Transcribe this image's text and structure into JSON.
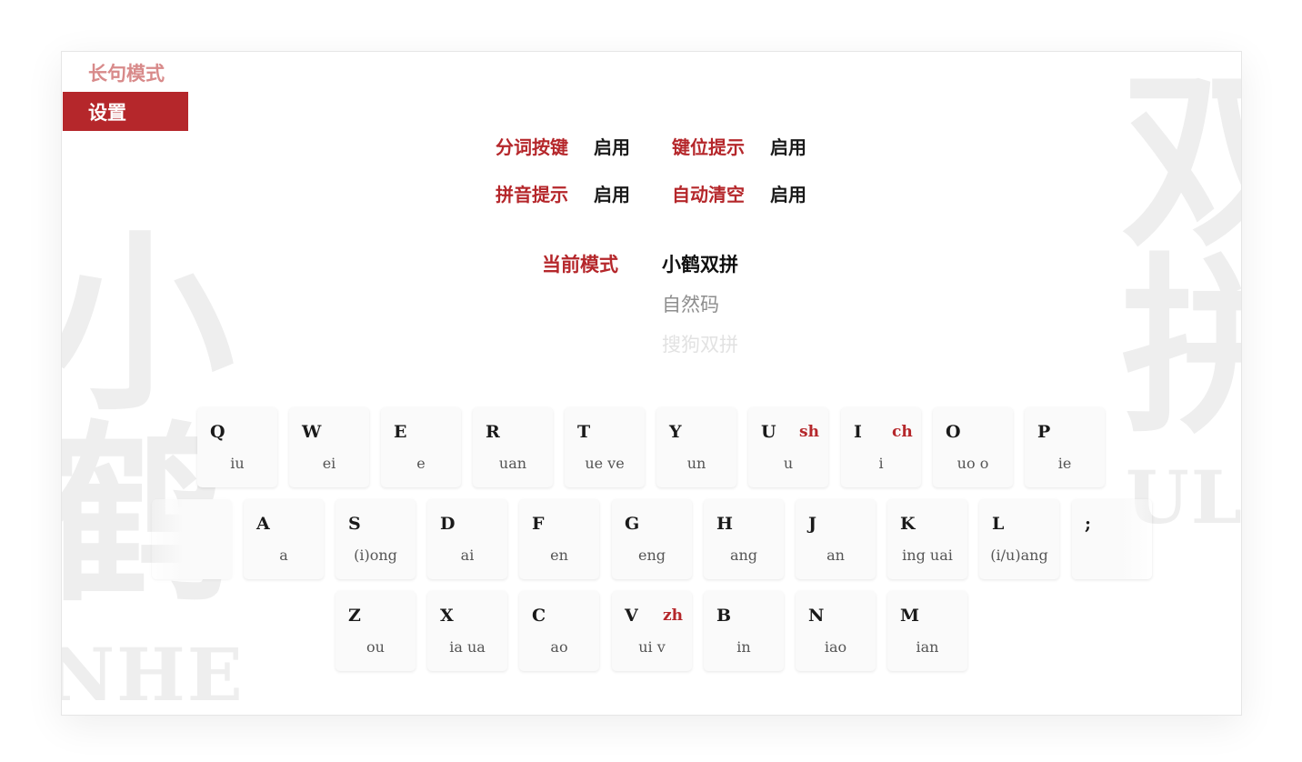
{
  "watermark": {
    "left_chars": [
      "小",
      "鹤"
    ],
    "left_text": "NHE",
    "right_chars": [
      "双",
      "拼"
    ],
    "right_text": "ULI"
  },
  "sidebar": {
    "items": [
      {
        "label": "长句模式",
        "active": false
      },
      {
        "label": "设置",
        "active": true
      }
    ]
  },
  "settings": {
    "options": [
      {
        "label": "分词按键",
        "value": "启用"
      },
      {
        "label": "键位提示",
        "value": "启用"
      },
      {
        "label": "拼音提示",
        "value": "启用"
      },
      {
        "label": "自动清空",
        "value": "启用"
      }
    ],
    "mode_label": "当前模式",
    "modes": [
      {
        "label": "小鹤双拼",
        "state": "selected"
      },
      {
        "label": "自然码",
        "state": "secondary"
      },
      {
        "label": "搜狗双拼",
        "state": "faded"
      }
    ]
  },
  "keyboard": {
    "rows": [
      [
        {
          "letter": "Q",
          "initial": "",
          "final": "iu"
        },
        {
          "letter": "W",
          "initial": "",
          "final": "ei"
        },
        {
          "letter": "E",
          "initial": "",
          "final": "e"
        },
        {
          "letter": "R",
          "initial": "",
          "final": "uan"
        },
        {
          "letter": "T",
          "initial": "",
          "final": "ue ve"
        },
        {
          "letter": "Y",
          "initial": "",
          "final": "un"
        },
        {
          "letter": "U",
          "initial": "sh",
          "final": "u"
        },
        {
          "letter": "I",
          "initial": "ch",
          "final": "i"
        },
        {
          "letter": "O",
          "initial": "",
          "final": "uo o"
        },
        {
          "letter": "P",
          "initial": "",
          "final": "ie"
        }
      ],
      [
        {
          "letter": "",
          "initial": "",
          "final": ""
        },
        {
          "letter": "A",
          "initial": "",
          "final": "a"
        },
        {
          "letter": "S",
          "initial": "",
          "final": "(i)ong"
        },
        {
          "letter": "D",
          "initial": "",
          "final": "ai"
        },
        {
          "letter": "F",
          "initial": "",
          "final": "en"
        },
        {
          "letter": "G",
          "initial": "",
          "final": "eng"
        },
        {
          "letter": "H",
          "initial": "",
          "final": "ang"
        },
        {
          "letter": "J",
          "initial": "",
          "final": "an"
        },
        {
          "letter": "K",
          "initial": "",
          "final": "ing uai"
        },
        {
          "letter": "L",
          "initial": "",
          "final": "(i/u)ang"
        },
        {
          "letter": ";",
          "initial": "",
          "final": ""
        }
      ],
      [
        {
          "letter": "Z",
          "initial": "",
          "final": "ou"
        },
        {
          "letter": "X",
          "initial": "",
          "final": "ia ua"
        },
        {
          "letter": "C",
          "initial": "",
          "final": "ao"
        },
        {
          "letter": "V",
          "initial": "zh",
          "final": "ui v"
        },
        {
          "letter": "B",
          "initial": "",
          "final": "in"
        },
        {
          "letter": "N",
          "initial": "",
          "final": "iao"
        },
        {
          "letter": "M",
          "initial": "",
          "final": "ian"
        }
      ]
    ]
  },
  "colors": {
    "accent": "#b5272b",
    "accent_light": "#d88a8a",
    "watermark": "#eeeeee",
    "key_bg": "#fafafa"
  }
}
